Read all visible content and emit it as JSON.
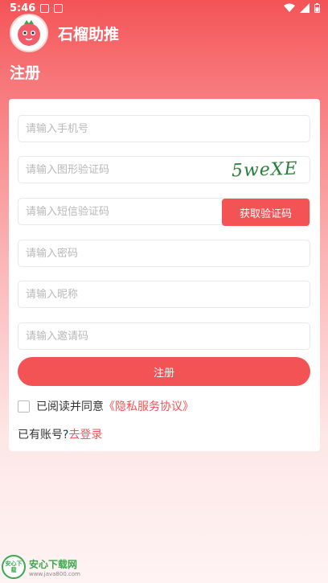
{
  "status_bar": {
    "time": "5:46",
    "icons": [
      "a-icon",
      "media-icon",
      "wifi-icon",
      "signal-icon",
      "battery-icon"
    ]
  },
  "app": {
    "title": "石榴助推",
    "logo_icon": "pomegranate-mascot-icon"
  },
  "page": {
    "title": "注册"
  },
  "form": {
    "phone_placeholder": "请输入手机号",
    "captcha_placeholder": "请输入图形验证码",
    "captcha_text": "5weXE",
    "sms_placeholder": "请输入短信验证码",
    "sms_button": "获取验证码",
    "password_placeholder": "请输入密码",
    "nickname_placeholder": "请输入昵称",
    "invite_placeholder": "请输入邀请码",
    "register_button": "注册",
    "agree_prefix": "已阅读并同意",
    "agree_link": "《隐私服务协议》",
    "login_prefix": "已有账号?",
    "login_link": "去登录"
  },
  "watermark": {
    "name": "安心下载网",
    "url": "www.java800.com",
    "badge": "安心下载"
  },
  "colors": {
    "accent": "#f45356",
    "captcha": "#2b7d3a",
    "watermark": "#3aa84f"
  }
}
